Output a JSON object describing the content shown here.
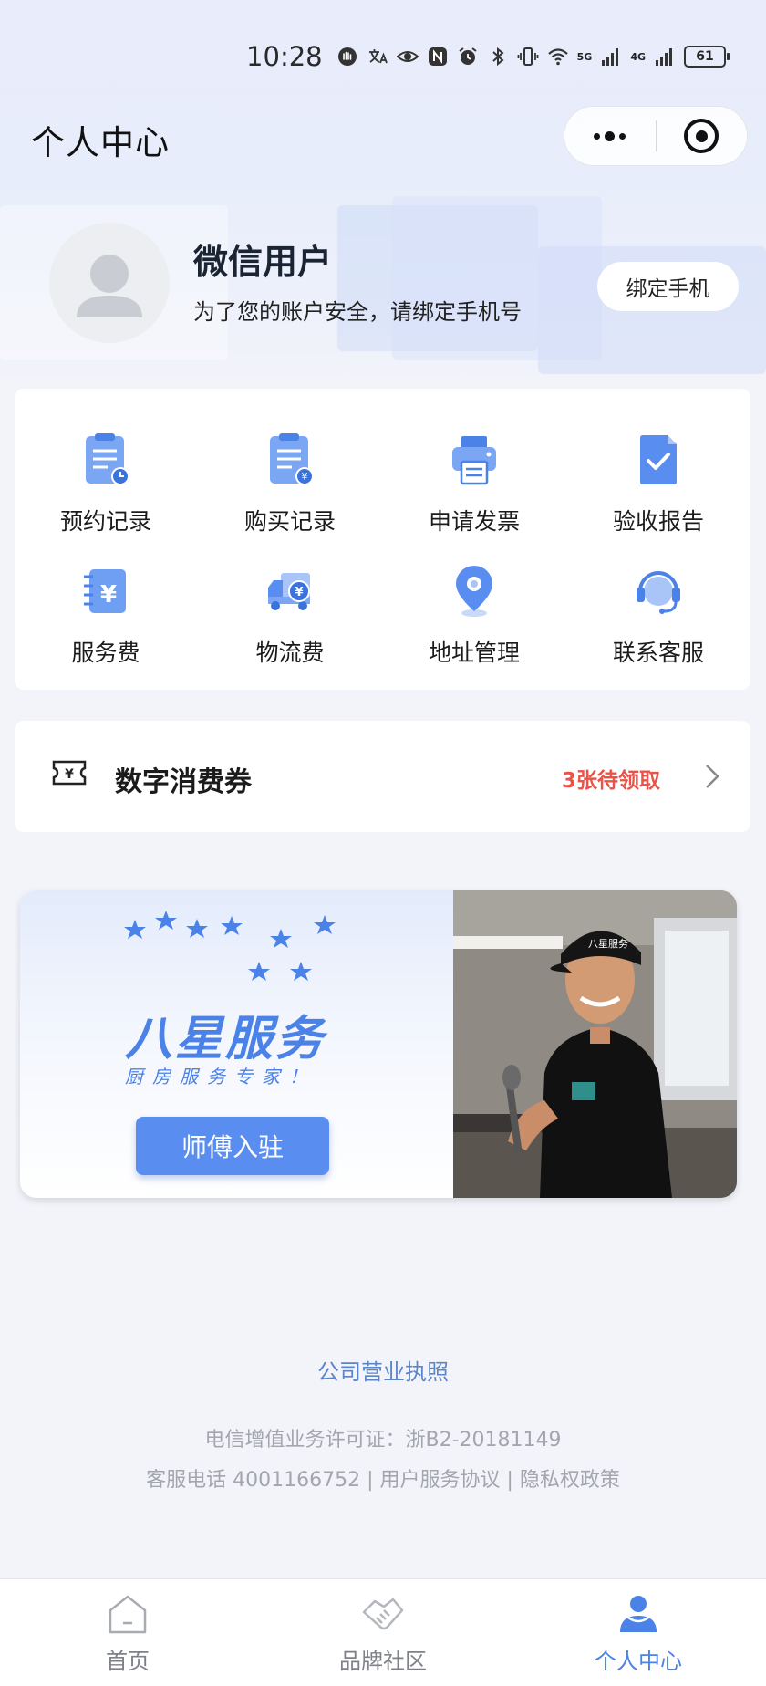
{
  "status_bar": {
    "time": "10:28",
    "battery": "61",
    "net1": "5G",
    "net2": "4G"
  },
  "header": {
    "title": "个人中心"
  },
  "profile": {
    "name": "微信用户",
    "tip": "为了您的账户安全，请绑定手机号",
    "bind_button": "绑定手机"
  },
  "grid": [
    {
      "label": "预约记录",
      "icon": "appointment-record-icon"
    },
    {
      "label": "购买记录",
      "icon": "purchase-record-icon"
    },
    {
      "label": "申请发票",
      "icon": "invoice-printer-icon"
    },
    {
      "label": "验收报告",
      "icon": "acceptance-report-icon"
    },
    {
      "label": "服务费",
      "icon": "service-fee-icon"
    },
    {
      "label": "物流费",
      "icon": "logistics-truck-icon"
    },
    {
      "label": "地址管理",
      "icon": "location-pin-icon"
    },
    {
      "label": "联系客服",
      "icon": "customer-service-headset-icon"
    }
  ],
  "coupon": {
    "title": "数字消费券",
    "status": "3张待领取"
  },
  "banner": {
    "title": "八星服务",
    "subtitle": "厨房服务专家！",
    "button": "师傅入驻",
    "cap_text": "八星服务"
  },
  "footer": {
    "license_link": "公司营业执照",
    "line1": "电信增值业务许可证：浙B2-20181149",
    "line2": "客服电话 4001166752 | 用户服务协议 | 隐私权政策"
  },
  "tabs": [
    {
      "label": "首页",
      "icon": "home-icon"
    },
    {
      "label": "品牌社区",
      "icon": "handshake-icon"
    },
    {
      "label": "个人中心",
      "icon": "person-icon"
    }
  ],
  "colors": {
    "accent": "#4a82e8",
    "coupon_status": "#e9544a",
    "link": "#5a86c9",
    "background": "#f3f4f9"
  }
}
